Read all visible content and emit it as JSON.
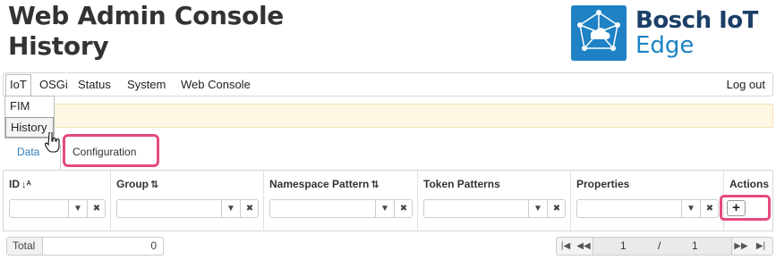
{
  "header": {
    "title_line1": "Web Admin Console",
    "title_line2": "History",
    "logo_line1": "Bosch IoT",
    "logo_line2": "Edge"
  },
  "nav": {
    "items": [
      "IoT",
      "OSGi",
      "Status",
      "System",
      "Web Console"
    ],
    "logout": "Log out",
    "dropdown": [
      "FIM",
      "History"
    ]
  },
  "tabs": {
    "data": "Data",
    "configuration": "Configuration"
  },
  "grid": {
    "columns": [
      {
        "title": "ID",
        "sort_icon": "sort-alpha-icon"
      },
      {
        "title": "Group",
        "sort_icon": "sort-icon"
      },
      {
        "title": "Namespace Pattern",
        "sort_icon": "sort-icon"
      },
      {
        "title": "Token Patterns",
        "sort_icon": ""
      },
      {
        "title": "Properties",
        "sort_icon": ""
      },
      {
        "title": "Actions",
        "sort_icon": ""
      }
    ],
    "add_label": "+"
  },
  "footer": {
    "total_label": "Total",
    "total_value": "0",
    "page_current": "1",
    "page_separator": "/",
    "page_total": "1"
  },
  "colors": {
    "highlight": "#e54b7a",
    "notice_bg": "#fcf8e3",
    "link": "#2a7dbd",
    "brand_blue": "#1e82c5",
    "brand_dark": "#1b3f67"
  }
}
